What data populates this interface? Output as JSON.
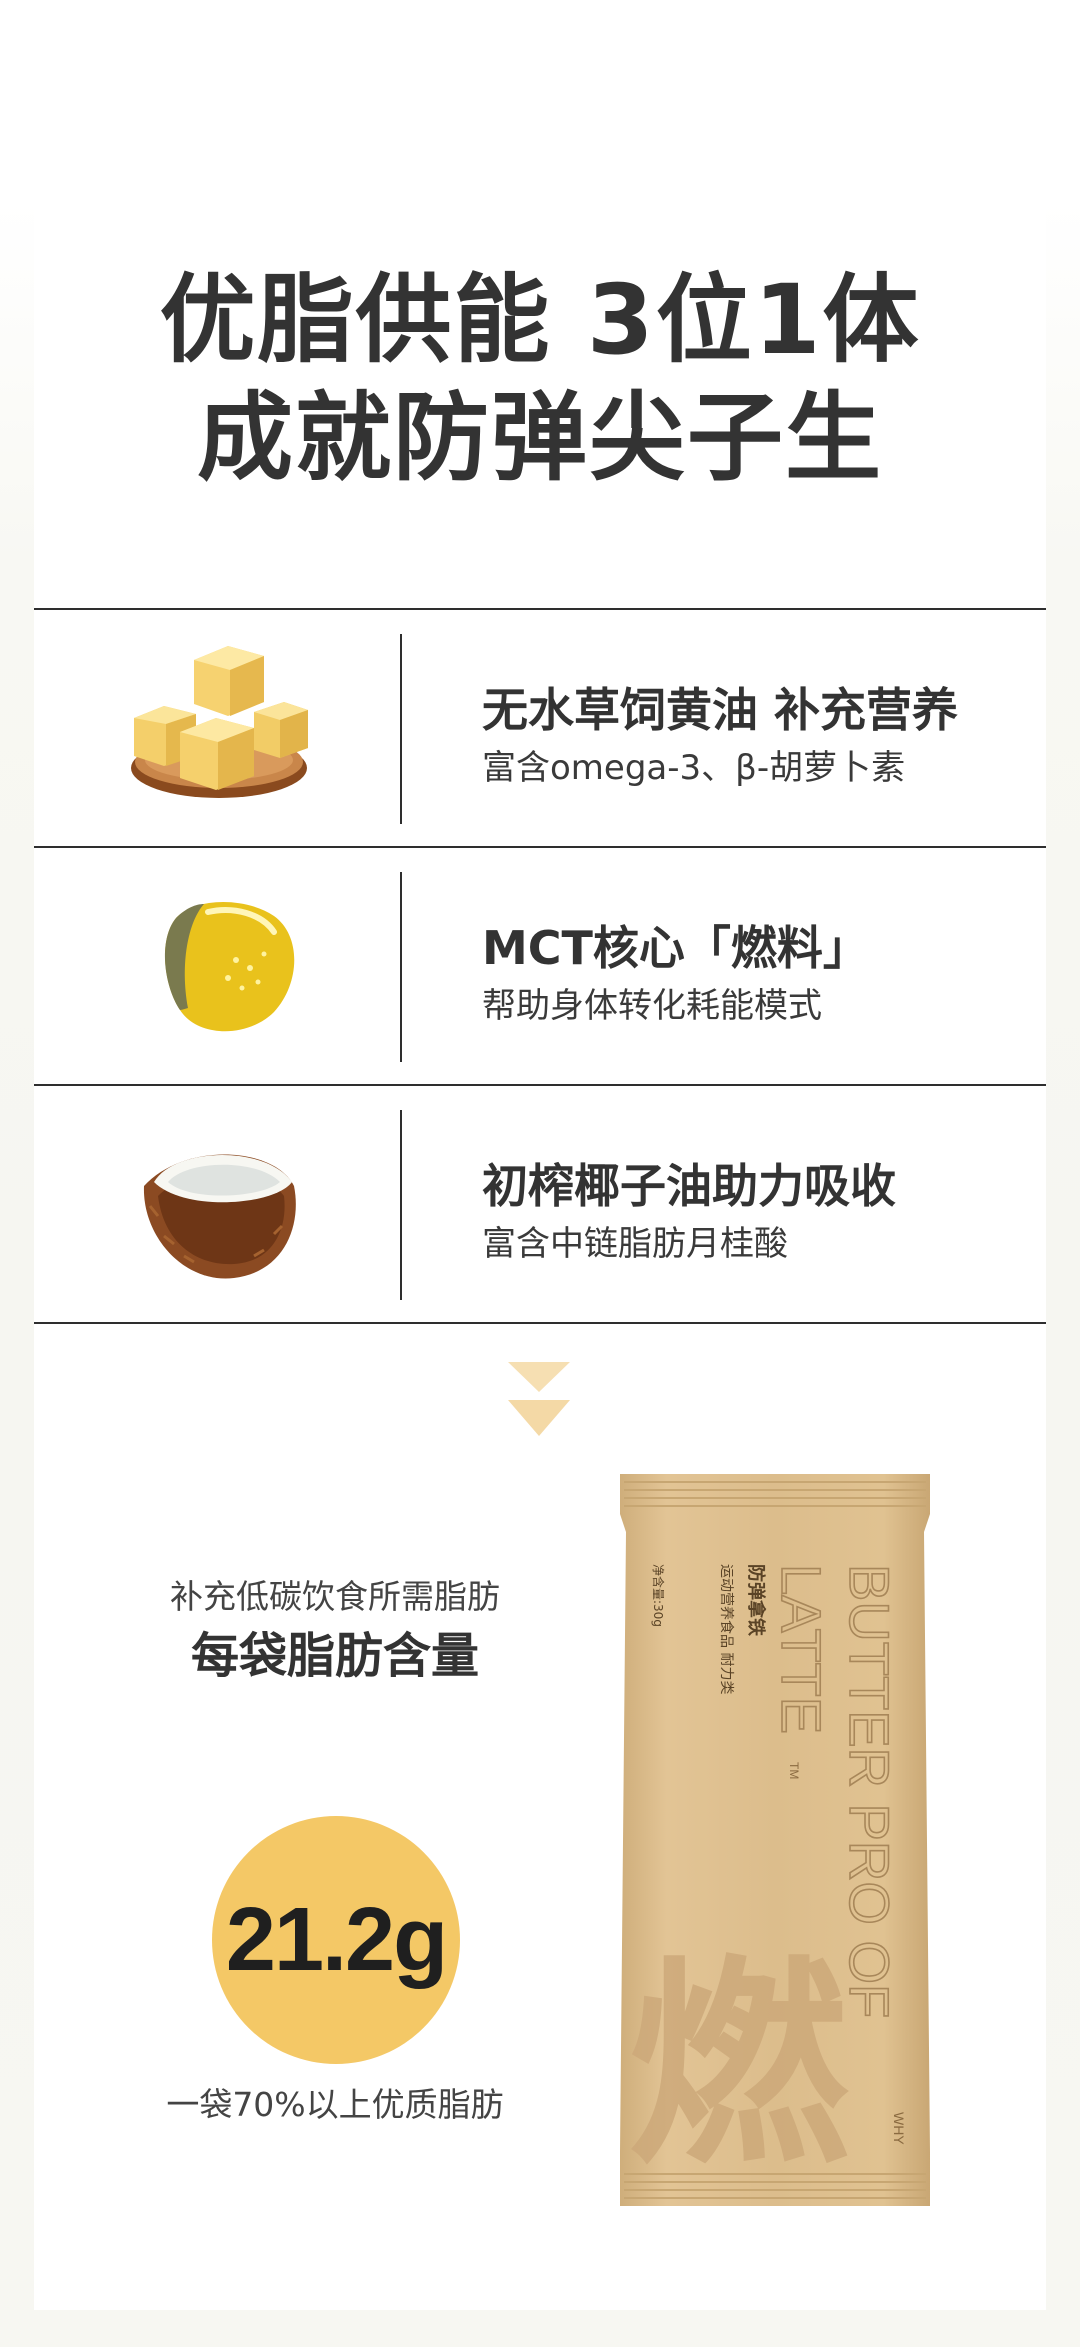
{
  "header": {
    "line1": "优脂供能 3位1体",
    "line2": "成就防弹尖子生"
  },
  "features": [
    {
      "title": "无水草饲黄油 补充营养",
      "desc": "富含omega-3、β-胡萝卜素",
      "icon": "butter-icon"
    },
    {
      "title": "MCT核心「燃料」",
      "desc": "帮助身体转化耗能模式",
      "icon": "oil-drop-icon"
    },
    {
      "title": "初榨椰子油助力吸收",
      "desc": "富含中链脂肪月桂酸",
      "icon": "coconut-icon"
    }
  ],
  "fat_section": {
    "lead": "补充低碳饮食所需脂肪",
    "title": "每袋脂肪含量",
    "amount": "21.2g",
    "note": "一袋70%以上优质脂肪"
  },
  "package": {
    "brand_en": [
      "BUTTER PRO OF",
      "LATTE"
    ],
    "tm": "TM",
    "product_cn": "防弹拿铁",
    "category": "运动营养食品 耐力类",
    "net_weight": "净含量:30g",
    "big_char": "燃",
    "logo_text": "WHY"
  },
  "colors": {
    "accent_yellow": "#f4c866",
    "package_tan": "#dcbd8c",
    "text_dark": "#333333"
  }
}
